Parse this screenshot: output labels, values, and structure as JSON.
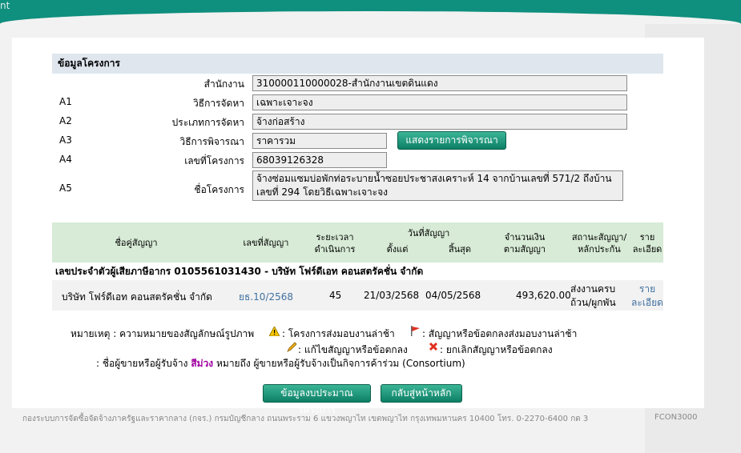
{
  "topbar": {
    "fragment": "nt"
  },
  "section_title": "ข้อมูลโครงการ",
  "fields": [
    {
      "code": "",
      "label": "สำนักงาน",
      "value": "310000110000028-สำนักงานเขตดินแดง"
    },
    {
      "code": "A1",
      "label": "วิธีการจัดหา",
      "value": "เฉพาะเจาะจง"
    },
    {
      "code": "A2",
      "label": "ประเภทการจัดหา",
      "value": "จ้างก่อสร้าง"
    },
    {
      "code": "A3",
      "label": "วิธีการพิจารณา",
      "value": "ราคารวม"
    },
    {
      "code": "A4",
      "label": "เลขที่โครงการ",
      "value": "68039126328"
    },
    {
      "code": "A5",
      "label": "ชื่อโครงการ",
      "value": "จ้างซ่อมแซมบ่อพักท่อระบายน้ำซอยประชาสงเคราะห์ 14  จากบ้านเลขที่ 571/2  ถึงบ้านเลขที่ 294 โดยวิธีเฉพาะเจาะจง"
    }
  ],
  "show_criteria_button": "แสดงรายการพิจารณา",
  "table": {
    "headers": {
      "party": "ชื่อคู่สัญญา",
      "contract_no": "เลขที่สัญญา",
      "duration_1": "ระยะเวลา",
      "duration_2": "ดำเนินการ",
      "date_group": "วันที่สัญญา",
      "date_from": "ตั้งแต่",
      "date_to": "สิ้นสุด",
      "amount_1": "จำนวนเงิน",
      "amount_2": "ตามสัญญา",
      "status_1": "สถานะสัญญา/",
      "status_2": "หลักประกัน",
      "detail_1": "ราย",
      "detail_2": "ละเอียด"
    },
    "group_label": "เลขประจำตัวผู้เสียภาษีอากร 0105561031430 - บริษัท โฟร์ดีเอท คอนสตรัคชั่น จำกัด",
    "rows": [
      {
        "party": "บริษัท โฟร์ดีเอท คอนสตรัคชั่น จำกัด",
        "contract_no": "ยธ.10/2568",
        "duration": "45",
        "date_from": "21/03/2568",
        "date_to": "04/05/2568",
        "amount": "493,620.00",
        "status_1": "ส่งงานครบ",
        "status_2": "ถ้วน/ผูกพัน",
        "detail_1": "ราย",
        "detail_2": "ละเอียด"
      }
    ]
  },
  "legend": {
    "title": "หมายเหตุ : ความหมายของสัญลักษณ์รูปภาพ",
    "late_delivery": ": โครงการส่งมอบงานล่าช้า",
    "contract_late": ": สัญญาหรือข้อตกลงส่งมอบงานล่าช้า",
    "edit": ": แก้ไขสัญญาหรือข้อตกลง",
    "cancel": ": ยกเลิกสัญญาหรือข้อตกลง",
    "consortium_prefix": ": ชื่อผู้ขายหรือผู้รับจ้าง",
    "consortium_color_word": "สีม่วง",
    "consortium_suffix": "หมายถึง ผู้ขายหรือผู้รับจ้างเป็นกิจการค้าร่วม (Consortium)"
  },
  "buttons": {
    "budget": "ข้อมูลงบประมาณโครงการ",
    "home": "กลับสู่หน้าหลัก"
  },
  "footer": {
    "address": "กองระบบการจัดซื้อจัดจ้างภาครัฐและราคากลาง (กจร.) กรมบัญชีกลาง ถนนพระราม 6 แขวงพญาไท เขตพญาไท กรุงเทพมหานคร 10400 โทร. 0-2270-6400 กด 3",
    "code": "FCON3000"
  },
  "colors": {
    "header_green": "#0f8f7e",
    "table_head": "#d7ebd6",
    "section_head": "#dfe6ee",
    "consortium": "#a000a0"
  }
}
